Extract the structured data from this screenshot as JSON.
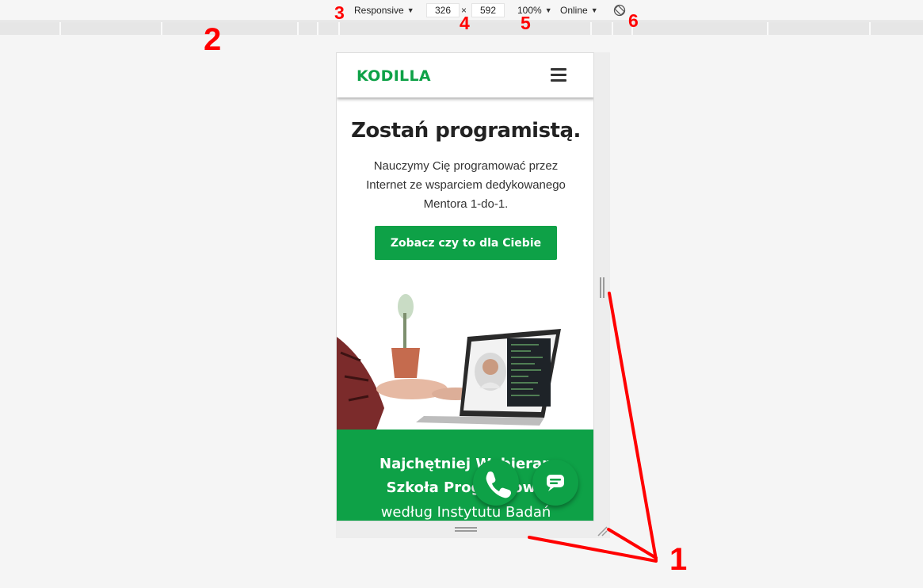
{
  "toolbar": {
    "device_label": "Responsive",
    "width_value": "326",
    "dim_separator": "×",
    "height_value": "592",
    "zoom_label": "100%",
    "network_label": "Online",
    "caret": "▼"
  },
  "annotations": {
    "n1": "1",
    "n2": "2",
    "n3": "3",
    "n4": "4",
    "n5": "5",
    "n6": "6"
  },
  "site": {
    "logo": "KODILLA",
    "title": "Zostań programistą.",
    "subtitle": "Nauczymy Cię programować przez Internet ze wsparciem dedykowanego Mentora 1-do-1.",
    "cta_label": "Zobacz czy to dla Ciebie",
    "band_line_1": "Najchętniej Wybieran",
    "band_line_2": "Szkoła Programowa",
    "band_line_3": "według Instytutu Badań"
  },
  "colors": {
    "brand_green": "#0ea147",
    "annotation_red": "#ff0000"
  },
  "icons": [
    "hamburger-menu-icon",
    "rotate-icon",
    "phone-icon",
    "chat-icon",
    "resize-handle-icon"
  ]
}
